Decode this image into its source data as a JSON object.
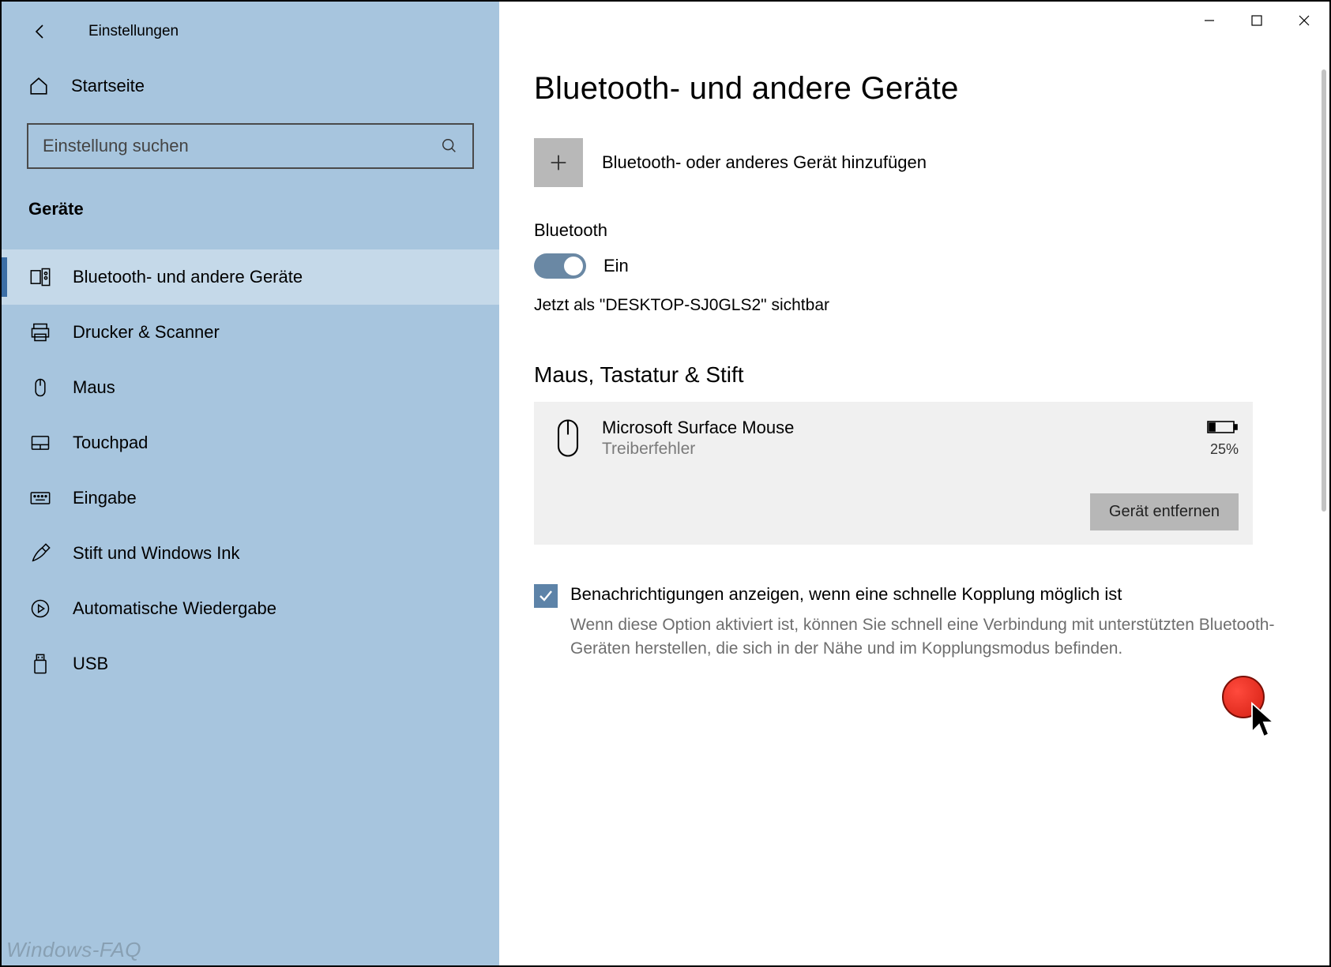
{
  "app_title": "Einstellungen",
  "home_label": "Startseite",
  "search_placeholder": "Einstellung suchen",
  "category_label": "Geräte",
  "sidebar": {
    "items": [
      {
        "label": "Bluetooth- und andere Geräte",
        "icon": "devices-icon",
        "active": true
      },
      {
        "label": "Drucker & Scanner",
        "icon": "printer-icon"
      },
      {
        "label": "Maus",
        "icon": "mouse-icon"
      },
      {
        "label": "Touchpad",
        "icon": "touchpad-icon"
      },
      {
        "label": "Eingabe",
        "icon": "keyboard-icon"
      },
      {
        "label": "Stift und Windows Ink",
        "icon": "pen-icon"
      },
      {
        "label": "Automatische Wiedergabe",
        "icon": "autoplay-icon"
      },
      {
        "label": "USB",
        "icon": "usb-icon"
      }
    ]
  },
  "page": {
    "title": "Bluetooth- und andere Geräte",
    "add_label": "Bluetooth- oder anderes Gerät hinzufügen",
    "bt_section": "Bluetooth",
    "toggle_state": "Ein",
    "visible_as": "Jetzt als \"DESKTOP-SJ0GLS2\" sichtbar",
    "group_title": "Maus, Tastatur & Stift",
    "device": {
      "name": "Microsoft Surface Mouse",
      "status": "Treiberfehler",
      "battery_pct": "25%"
    },
    "remove_label": "Gerät entfernen",
    "notif_title": "Benachrichtigungen anzeigen, wenn eine schnelle Kopplung möglich ist",
    "notif_desc": "Wenn diese Option aktiviert ist, können Sie schnell eine Verbindung mit unterstützten Bluetooth-Geräten herstellen, die sich in der Nähe und im Kopplungsmodus befinden."
  },
  "watermark": "Windows-FAQ"
}
